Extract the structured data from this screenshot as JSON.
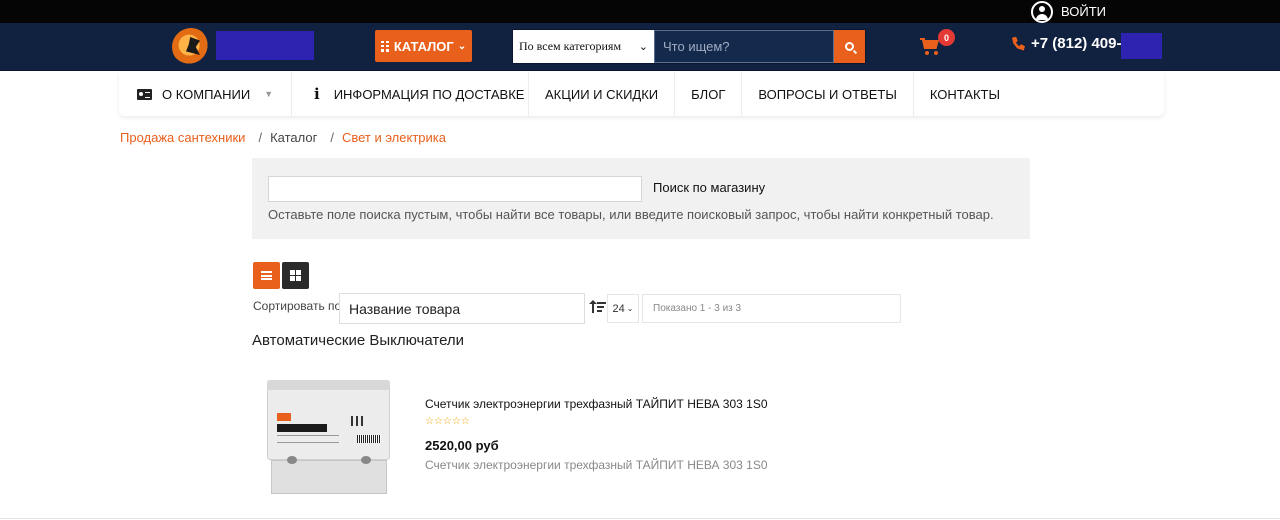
{
  "topbar": {
    "login_label": "ВОЙТИ",
    "icon": "user-circle-icon"
  },
  "header": {
    "catalog_label": "КАТАЛОГ",
    "category_select": "По всем категориям",
    "search_placeholder": "Что ищем?",
    "cart_count": "0",
    "phone": "+7 (812) 409-",
    "colors": {
      "topbar": "#050505",
      "header": "#10223f",
      "accent": "#e8601c",
      "redaction": "#2d23b0",
      "badge": "#e53935"
    }
  },
  "nav": {
    "items": [
      {
        "label": "О КОМПАНИИ",
        "icon": "id-card-icon"
      },
      {
        "label": "ИНФОРМАЦИЯ ПО ДОСТАВКЕ",
        "icon": "info-icon"
      },
      {
        "label": "АКЦИИ И СКИДКИ"
      },
      {
        "label": "БЛОГ"
      },
      {
        "label": "ВОПРОСЫ И ОТВЕТЫ"
      },
      {
        "label": "КОНТАКТЫ"
      }
    ]
  },
  "breadcrumb": {
    "items": [
      "Продажа сантехники",
      "Каталог",
      "Свет и электрика"
    ],
    "separator": "/"
  },
  "store_search": {
    "value": "",
    "button_label": "Поиск по магазину",
    "hint": "Оставьте поле поиска пустым, чтобы найти все товары, или введите поисковый запрос, чтобы найти конкретный товар."
  },
  "listing": {
    "sort_label": "Сортировать по",
    "sort_value": "Название товара",
    "limit_value": "24",
    "results_text": "Показано 1 - 3 из 3",
    "section_title": "Автоматические Выключатели"
  },
  "products": [
    {
      "title": "Счетчик электроэнергии трехфазный ТАЙПИТ НЕВА 303 1S0",
      "rating": "☆☆☆☆☆",
      "price": "2520,00 руб",
      "description": "Счетчик электроэнергии трехфазный ТАЙПИТ НЕВА 303 1S0"
    }
  ]
}
